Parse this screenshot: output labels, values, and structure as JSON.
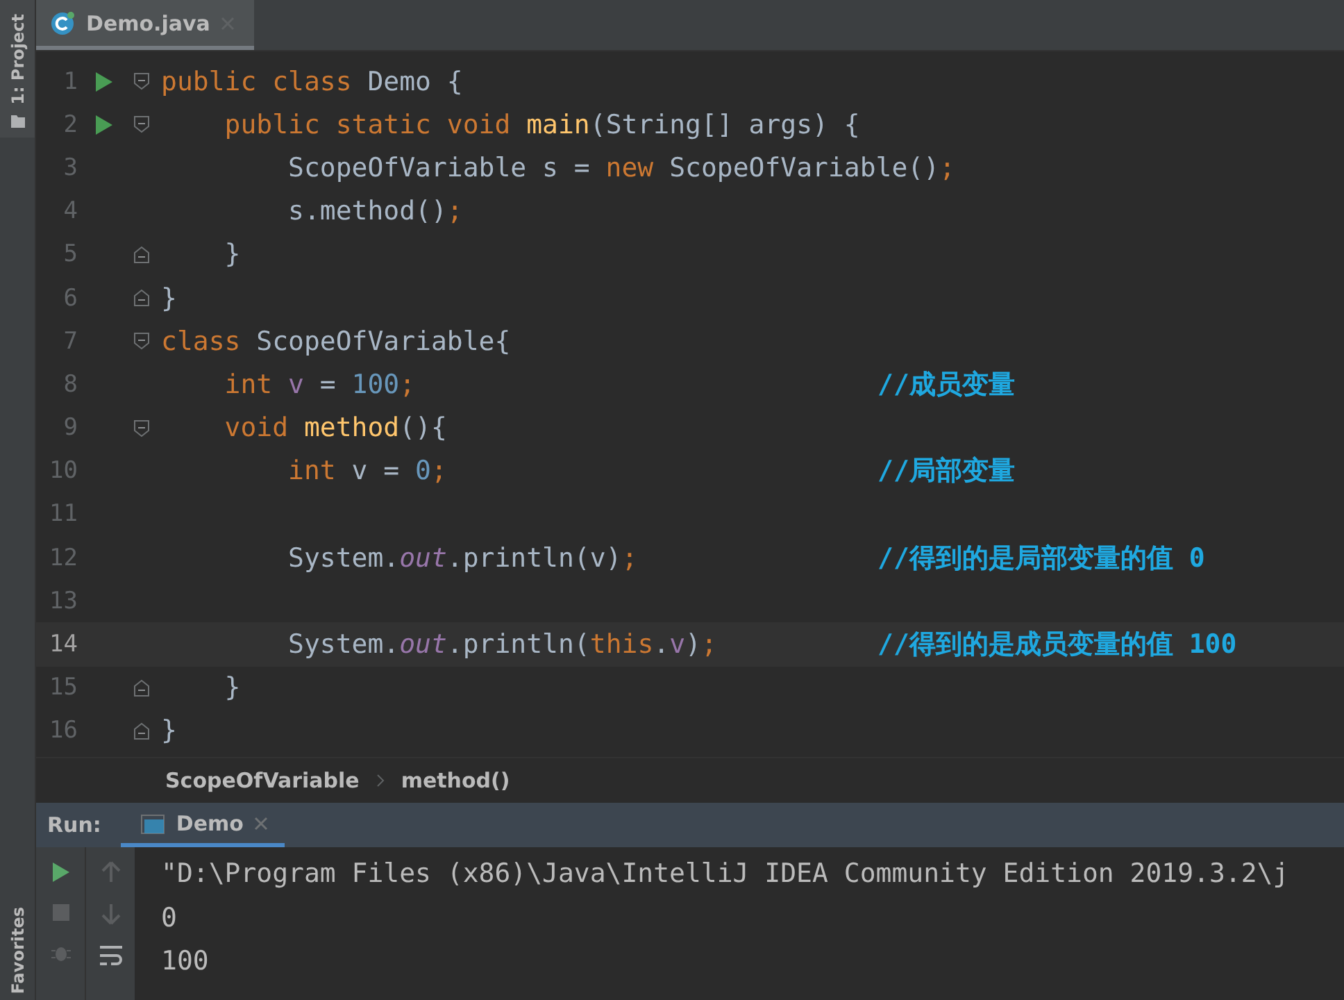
{
  "side_strip": {
    "top_label": "1: Project",
    "bottom_label": "Favorites"
  },
  "editor_tabs": [
    {
      "label": "Demo.java",
      "selected": true
    }
  ],
  "lines": [
    {
      "number": "1",
      "run_marker": true,
      "fold_start": true,
      "fold_end": false,
      "current": false,
      "tokens": [
        {
          "kind": "keyword",
          "text": "public class "
        },
        {
          "kind": "plain",
          "text": "Demo {"
        }
      ]
    },
    {
      "number": "2",
      "run_marker": true,
      "fold_start": true,
      "fold_end": false,
      "current": false,
      "tokens": [
        {
          "kind": "keyword",
          "text": "    public static void "
        },
        {
          "kind": "method",
          "text": "main"
        },
        {
          "kind": "plain",
          "text": "(String[] args) {"
        }
      ]
    },
    {
      "number": "3",
      "run_marker": false,
      "fold_start": false,
      "fold_end": false,
      "current": false,
      "tokens": [
        {
          "kind": "plain",
          "text": "        ScopeOfVariable s = "
        },
        {
          "kind": "keyword",
          "text": "new "
        },
        {
          "kind": "plain",
          "text": "ScopeOfVariable()"
        },
        {
          "kind": "keyword",
          "text": ";"
        }
      ]
    },
    {
      "number": "4",
      "run_marker": false,
      "fold_start": false,
      "fold_end": false,
      "current": false,
      "tokens": [
        {
          "kind": "plain",
          "text": "        s.method()"
        },
        {
          "kind": "keyword",
          "text": ";"
        }
      ]
    },
    {
      "number": "5",
      "run_marker": false,
      "fold_start": false,
      "fold_end": true,
      "current": false,
      "tokens": [
        {
          "kind": "plain",
          "text": "    }"
        }
      ]
    },
    {
      "number": "6",
      "run_marker": false,
      "fold_start": false,
      "fold_end": true,
      "current": false,
      "tokens": [
        {
          "kind": "plain",
          "text": "}"
        }
      ]
    },
    {
      "number": "7",
      "run_marker": false,
      "fold_start": true,
      "fold_end": false,
      "current": false,
      "tokens": [
        {
          "kind": "keyword",
          "text": "class "
        },
        {
          "kind": "plain",
          "text": "ScopeOfVariable{"
        }
      ]
    },
    {
      "number": "8",
      "run_marker": false,
      "fold_start": false,
      "fold_end": false,
      "current": false,
      "tokens": [
        {
          "kind": "keyword",
          "text": "    int "
        },
        {
          "kind": "field",
          "text": "v"
        },
        {
          "kind": "plain",
          "text": " = "
        },
        {
          "kind": "number",
          "text": "100"
        },
        {
          "kind": "keyword",
          "text": ";"
        }
      ],
      "comment": "//成员变量"
    },
    {
      "number": "9",
      "run_marker": false,
      "fold_start": true,
      "fold_end": false,
      "current": false,
      "tokens": [
        {
          "kind": "keyword",
          "text": "    void "
        },
        {
          "kind": "method",
          "text": "method"
        },
        {
          "kind": "plain",
          "text": "(){"
        }
      ]
    },
    {
      "number": "10",
      "run_marker": false,
      "fold_start": false,
      "fold_end": false,
      "current": false,
      "tokens": [
        {
          "kind": "keyword",
          "text": "        int "
        },
        {
          "kind": "plain",
          "text": "v = "
        },
        {
          "kind": "number",
          "text": "0"
        },
        {
          "kind": "keyword",
          "text": ";"
        }
      ],
      "comment": "//局部变量"
    },
    {
      "number": "11",
      "run_marker": false,
      "fold_start": false,
      "fold_end": false,
      "current": false
    },
    {
      "number": "12",
      "run_marker": false,
      "fold_start": false,
      "fold_end": false,
      "current": false,
      "tokens": [
        {
          "kind": "plain",
          "text": "        System."
        },
        {
          "kind": "static",
          "text": "out"
        },
        {
          "kind": "plain",
          "text": ".println(v)"
        },
        {
          "kind": "keyword",
          "text": ";"
        }
      ],
      "comment": "//得到的是局部变量的值 0"
    },
    {
      "number": "13",
      "run_marker": false,
      "fold_start": false,
      "fold_end": false,
      "current": false
    },
    {
      "number": "14",
      "run_marker": false,
      "fold_start": false,
      "fold_end": false,
      "current": true,
      "tokens": [
        {
          "kind": "plain",
          "text": "        System."
        },
        {
          "kind": "static",
          "text": "out"
        },
        {
          "kind": "plain",
          "text": ".println("
        },
        {
          "kind": "keyword",
          "text": "this"
        },
        {
          "kind": "plain",
          "text": "."
        },
        {
          "kind": "field",
          "text": "v"
        },
        {
          "kind": "plain",
          "text": ")"
        },
        {
          "kind": "keyword",
          "text": ";"
        }
      ],
      "comment": "//得到的是成员变量的值 100"
    },
    {
      "number": "15",
      "run_marker": false,
      "fold_start": false,
      "fold_end": true,
      "current": false,
      "tokens": [
        {
          "kind": "plain",
          "text": "    }"
        }
      ]
    },
    {
      "number": "16",
      "run_marker": false,
      "fold_start": false,
      "fold_end": true,
      "current": false,
      "tokens": [
        {
          "kind": "plain",
          "text": "}"
        }
      ]
    }
  ],
  "breadcrumbs": [
    "ScopeOfVariable",
    "method()"
  ],
  "run_panel": {
    "label": "Run:",
    "tabs": [
      {
        "label": "Demo",
        "selected": true
      }
    ],
    "console": [
      "\"D:\\Program Files (x86)\\Java\\IntelliJ IDEA Community Edition 2019.3.2\\j",
      "0",
      "100"
    ]
  }
}
